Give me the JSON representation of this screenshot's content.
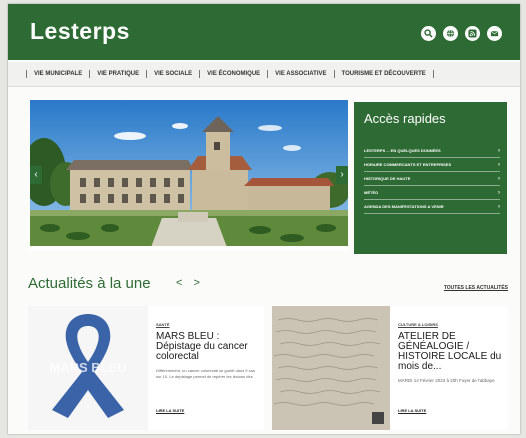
{
  "header": {
    "title": "Lesterps",
    "icons": [
      "search-icon",
      "globe-icon",
      "rss-icon",
      "mail-icon"
    ]
  },
  "nav": {
    "items": [
      "VIE MUNICIPALE",
      "VIE PRATIQUE",
      "VIE SOCIALE",
      "VIE ÉCONOMIQUE",
      "VIE ASSOCIATIVE",
      "TOURISME ET DÉCOUVERTE"
    ]
  },
  "quick": {
    "title": "Accès rapides",
    "items": [
      "LESTERPS ... EN QUELQUES DONNÉES",
      "HORAIRE COMMERCANTS ET ENTREPRISES",
      "HISTORIQUE DE HAUTE",
      "MÉTÉO",
      "AGENDA DES MANIFESTATIONS A VENIR"
    ]
  },
  "news": {
    "heading": "Actualités à la une",
    "nav_arrows": "< >",
    "all_link": "TOUTES LES ACTUALITÉS",
    "cards": [
      {
        "image_text": "MARS BLEU",
        "category": "SANTÉ",
        "title": "MARS BLEU : Dépistage du cancer colorectal",
        "excerpt": "Différemment, un cancer colorectal se guérit dans 9 cas sur 10. Le dépistage permet de repérer les lésions dès",
        "more": "LIRE LA SUITE"
      },
      {
        "category": "CULTURE & LOISIRS",
        "title": "ATELIER DE GÉNÉALOGIE / HISTOIRE LOCALE du mois de...",
        "date": "MARDI 14 Février 2023 à 20h Foyer de l'abbaye",
        "more": "LIRE LA SUITE"
      }
    ]
  },
  "colors": {
    "brand_green": "#2e6b34",
    "ribbon_blue": "#3b63a8"
  }
}
